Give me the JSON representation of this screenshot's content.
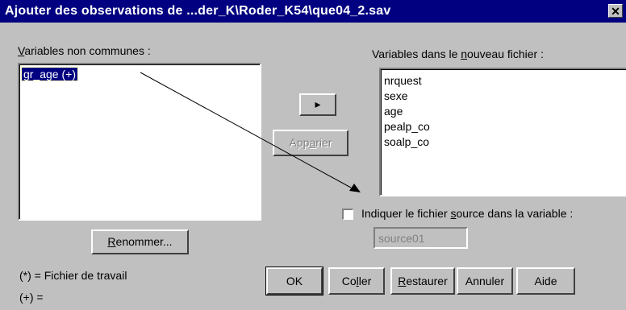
{
  "window": {
    "title": "Ajouter des observations de ...der_K\\Roder_K54\\que04_2.sav",
    "close_glyph": "✕"
  },
  "left_panel": {
    "label_first": "V",
    "label_rest": "ariables non communes :",
    "items": [
      "gr_age (+)"
    ]
  },
  "right_panel": {
    "label_a": "Variables dans le ",
    "label_b": "n",
    "label_c": "ouveau fichier :",
    "items": [
      "nrquest",
      "sexe",
      "age",
      "pealp_co",
      "soalp_co"
    ]
  },
  "move_button": {
    "glyph": "▸"
  },
  "pair_button": {
    "a": "App",
    "b": "a",
    "c": "rier"
  },
  "rename_button": {
    "a": "R",
    "b": "enommer..."
  },
  "source_checkbox": {
    "label_a": "Indiquer le fichier ",
    "label_b": "s",
    "label_c": "ource dans la variable :",
    "checked": false
  },
  "source_field": {
    "value": "source01"
  },
  "legend": {
    "working": "(*) = Fichier de travail",
    "plus": "(+) ="
  },
  "buttons": {
    "ok": "OK",
    "paste_a": "Co",
    "paste_b": "l",
    "paste_c": "ler",
    "restore_a": "R",
    "restore_b": "estaurer",
    "cancel": "Annuler",
    "help": "Aide"
  }
}
